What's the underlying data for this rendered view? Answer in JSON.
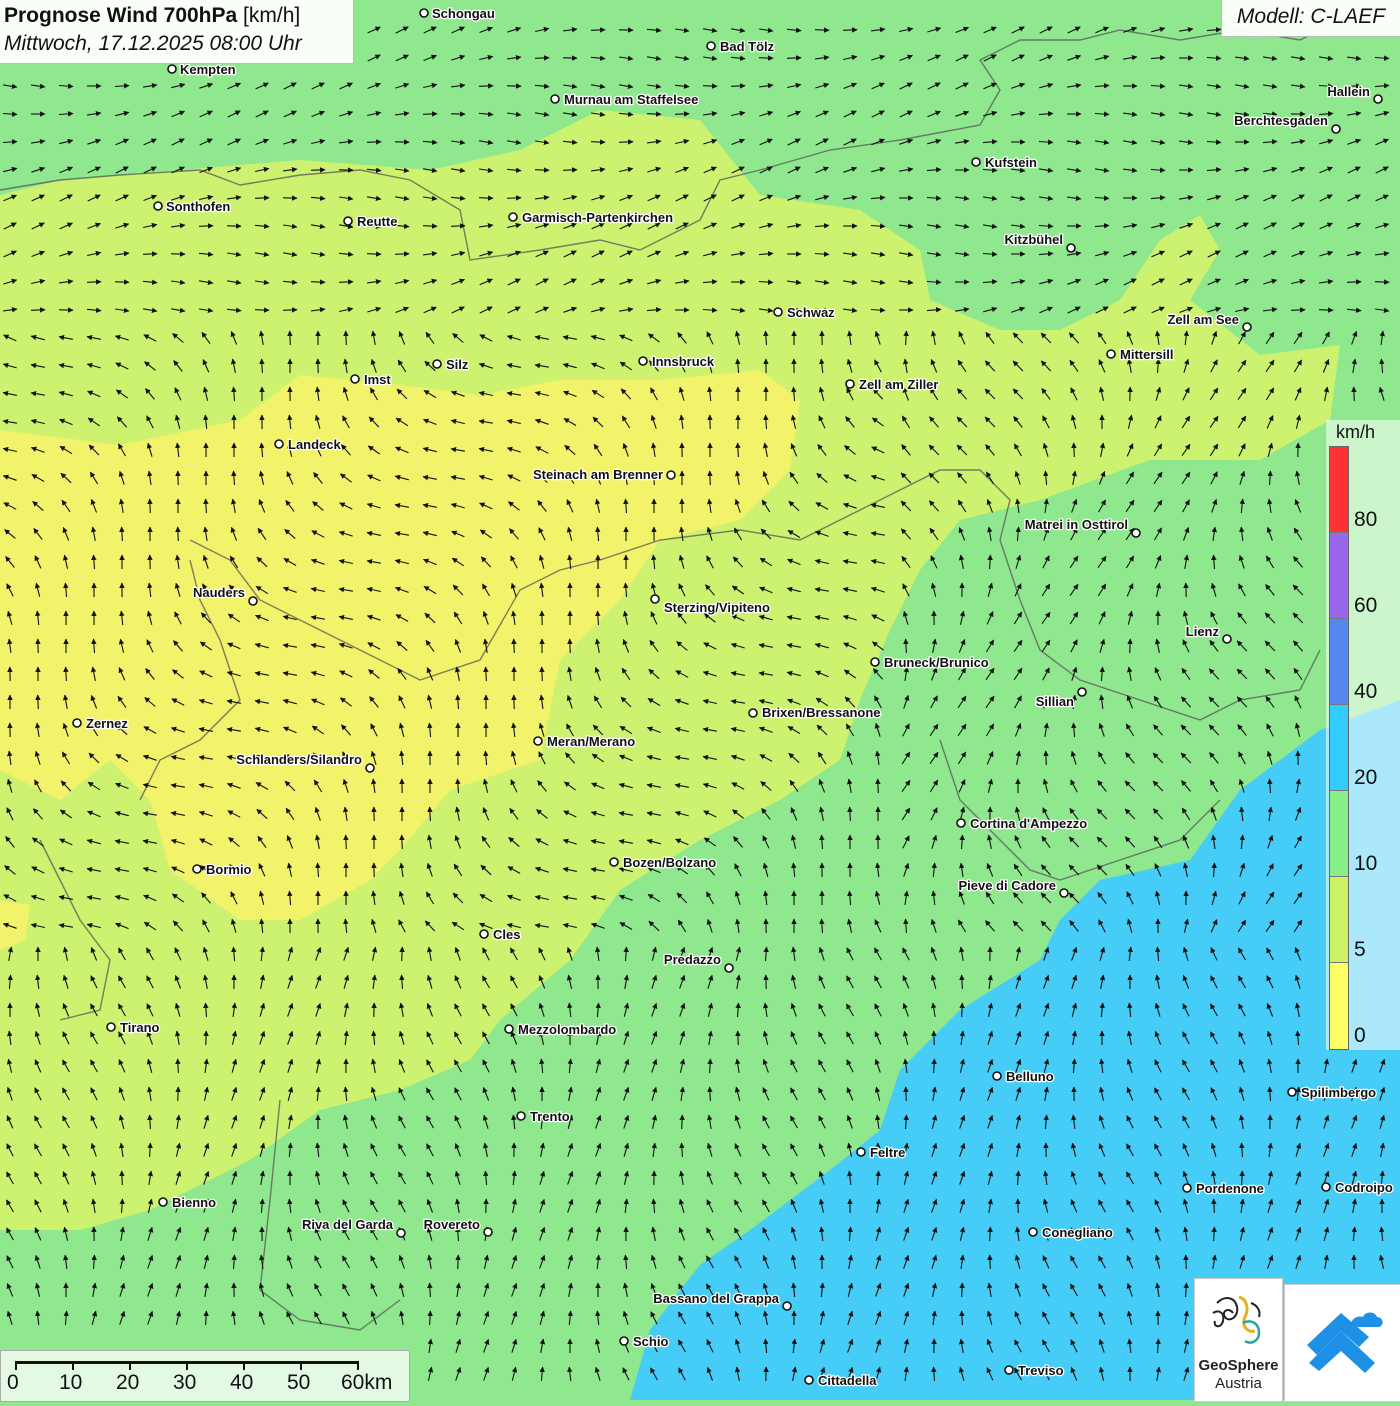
{
  "header": {
    "title_bold": "Prognose Wind 700hPa",
    "title_unit": "[km/h]",
    "datetime": "Mittwoch, 17.12.2025 08:00 Uhr",
    "model": "Modell: C-LAEF"
  },
  "legend": {
    "unit": "km/h",
    "labels": [
      "80",
      "60",
      "40",
      "20",
      "10",
      "5",
      "0"
    ],
    "colors": [
      "#ff3333",
      "#9966ee",
      "#5588ee",
      "#33ccff",
      "#88ee88",
      "#ccf266",
      "#ffff66"
    ]
  },
  "scale_bar": {
    "labels": [
      "0",
      "10",
      "20",
      "30",
      "40",
      "50",
      "60km"
    ]
  },
  "cities": [
    {
      "name": "Schongau"
    },
    {
      "name": "Bad Tölz"
    },
    {
      "name": "Kempten"
    },
    {
      "name": "Murnau am Staffelsee"
    },
    {
      "name": "Hallein"
    },
    {
      "name": "Berchtesgaden"
    },
    {
      "name": "Kufstein"
    },
    {
      "name": "Sonthofen"
    },
    {
      "name": "Reutte"
    },
    {
      "name": "Garmisch-Partenkirchen"
    },
    {
      "name": "Kitzbühel"
    },
    {
      "name": "Schwaz"
    },
    {
      "name": "Zell am See"
    },
    {
      "name": "Mittersill"
    },
    {
      "name": "Innsbruck"
    },
    {
      "name": "Silz"
    },
    {
      "name": "Imst"
    },
    {
      "name": "Zell am Ziller"
    },
    {
      "name": "Landeck"
    },
    {
      "name": "Steinach am Brenner"
    },
    {
      "name": "Matrei in Osttirol"
    },
    {
      "name": "Nauders"
    },
    {
      "name": "Sterzing/Vipiteno"
    },
    {
      "name": "Lienz"
    },
    {
      "name": "Bruneck/Brunico"
    },
    {
      "name": "Sillian"
    },
    {
      "name": "Zernez"
    },
    {
      "name": "Brixen/Bressanone"
    },
    {
      "name": "Meran/Merano"
    },
    {
      "name": "Schlanders/Silandro"
    },
    {
      "name": "Cortina d'Ampezzo"
    },
    {
      "name": "Bozen/Bolzano"
    },
    {
      "name": "Bormio"
    },
    {
      "name": "Pieve di Cadore"
    },
    {
      "name": "Cles"
    },
    {
      "name": "Predazzo"
    },
    {
      "name": "Tirano"
    },
    {
      "name": "Mezzolombardo"
    },
    {
      "name": "Belluno"
    },
    {
      "name": "Spilimbergo"
    },
    {
      "name": "Trento"
    },
    {
      "name": "Feltre"
    },
    {
      "name": "Pordenone"
    },
    {
      "name": "Codroipo"
    },
    {
      "name": "Bienno"
    },
    {
      "name": "Riva del Garda"
    },
    {
      "name": "Rovereto"
    },
    {
      "name": "Conegliano"
    },
    {
      "name": "Bassano del Grappa"
    },
    {
      "name": "Schio"
    },
    {
      "name": "Treviso"
    },
    {
      "name": "Cittadella"
    }
  ],
  "logo": {
    "name": "GeoSphere",
    "sub": "Austria"
  }
}
